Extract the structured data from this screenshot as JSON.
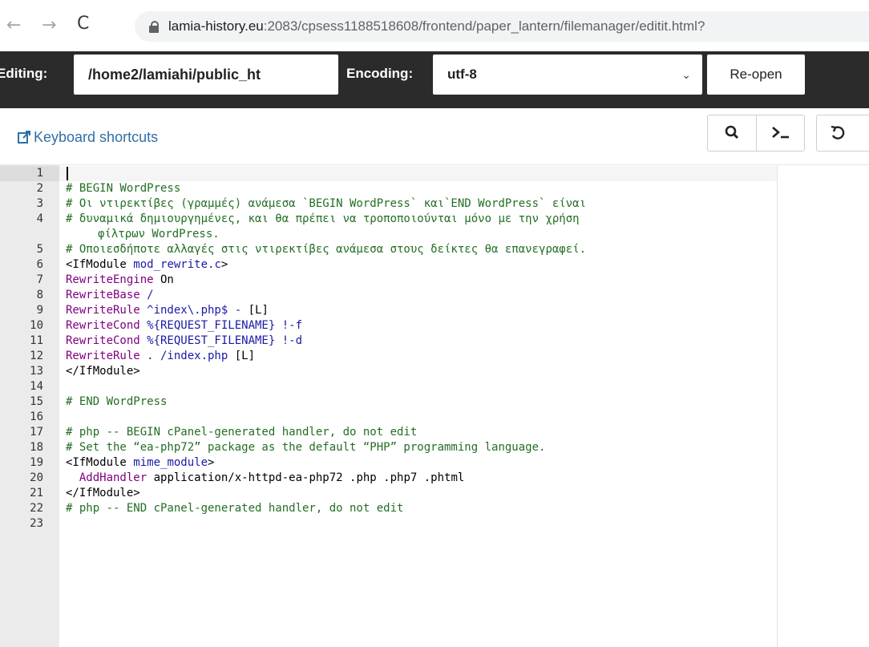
{
  "browser": {
    "url_host": "lamia-history.eu",
    "url_rest": ":2083/cpsess1188518608/frontend/paper_lantern/filemanager/editit.html?",
    "back_glyph": "←",
    "forward_glyph": "→",
    "reload_glyph": "C"
  },
  "toolbar": {
    "editing_label": "Editing:",
    "path_value": "/home2/lamiahi/public_ht",
    "encoding_label": "Encoding:",
    "encoding_value": "utf-8",
    "reopen_label": "Re-open"
  },
  "shortcuts": {
    "keyboard_shortcuts_label": "Keyboard shortcuts"
  },
  "icons": {
    "search": "search-icon",
    "terminal": "terminal-icon",
    "undo": "undo-icon",
    "external_link": "external-link-icon",
    "lock": "lock-icon"
  },
  "colors": {
    "toolbar_bg": "#2b2b2b",
    "link": "#2f6fa8",
    "comment": "#236e24",
    "directive": "#800080",
    "value": "#1a1aa6"
  },
  "editor": {
    "lines": [
      {
        "num": "1",
        "text": ""
      },
      {
        "num": "2",
        "text": "# BEGIN WordPress"
      },
      {
        "num": "3",
        "text": "# Οι ντιρεκτίβες (γραμμές) ανάμεσα `BEGIN WordPress` και`END WordPress` είναι"
      },
      {
        "num": "4",
        "text": "# δυναμικά δημιουργημένες, και θα πρέπει να τροποποιούνται μόνο με την χρήση"
      },
      {
        "num": "",
        "text": "φίλτρων WordPress."
      },
      {
        "num": "5",
        "text": "# Οποιεσδήποτε αλλαγές στις ντιρεκτίβες ανάμεσα στους δείκτες θα επανεγραφεί."
      },
      {
        "num": "6",
        "text": "<IfModule mod_rewrite.c>"
      },
      {
        "num": "7",
        "text": "RewriteEngine On"
      },
      {
        "num": "8",
        "text": "RewriteBase /"
      },
      {
        "num": "9",
        "text": "RewriteRule ^index\\.php$ - [L]"
      },
      {
        "num": "10",
        "text": "RewriteCond %{REQUEST_FILENAME} !-f"
      },
      {
        "num": "11",
        "text": "RewriteCond %{REQUEST_FILENAME} !-d"
      },
      {
        "num": "12",
        "text": "RewriteRule . /index.php [L]"
      },
      {
        "num": "13",
        "text": "</IfModule>"
      },
      {
        "num": "14",
        "text": ""
      },
      {
        "num": "15",
        "text": "# END WordPress"
      },
      {
        "num": "16",
        "text": ""
      },
      {
        "num": "17",
        "text": "# php -- BEGIN cPanel-generated handler, do not edit"
      },
      {
        "num": "18",
        "text": "# Set the “ea-php72” package as the default “PHP” programming language."
      },
      {
        "num": "19",
        "text": "<IfModule mime_module>"
      },
      {
        "num": "20",
        "text": "  AddHandler application/x-httpd-ea-php72 .php .php7 .phtml"
      },
      {
        "num": "21",
        "text": "</IfModule>"
      },
      {
        "num": "22",
        "text": "# php -- END cPanel-generated handler, do not edit"
      },
      {
        "num": "23",
        "text": ""
      }
    ]
  }
}
